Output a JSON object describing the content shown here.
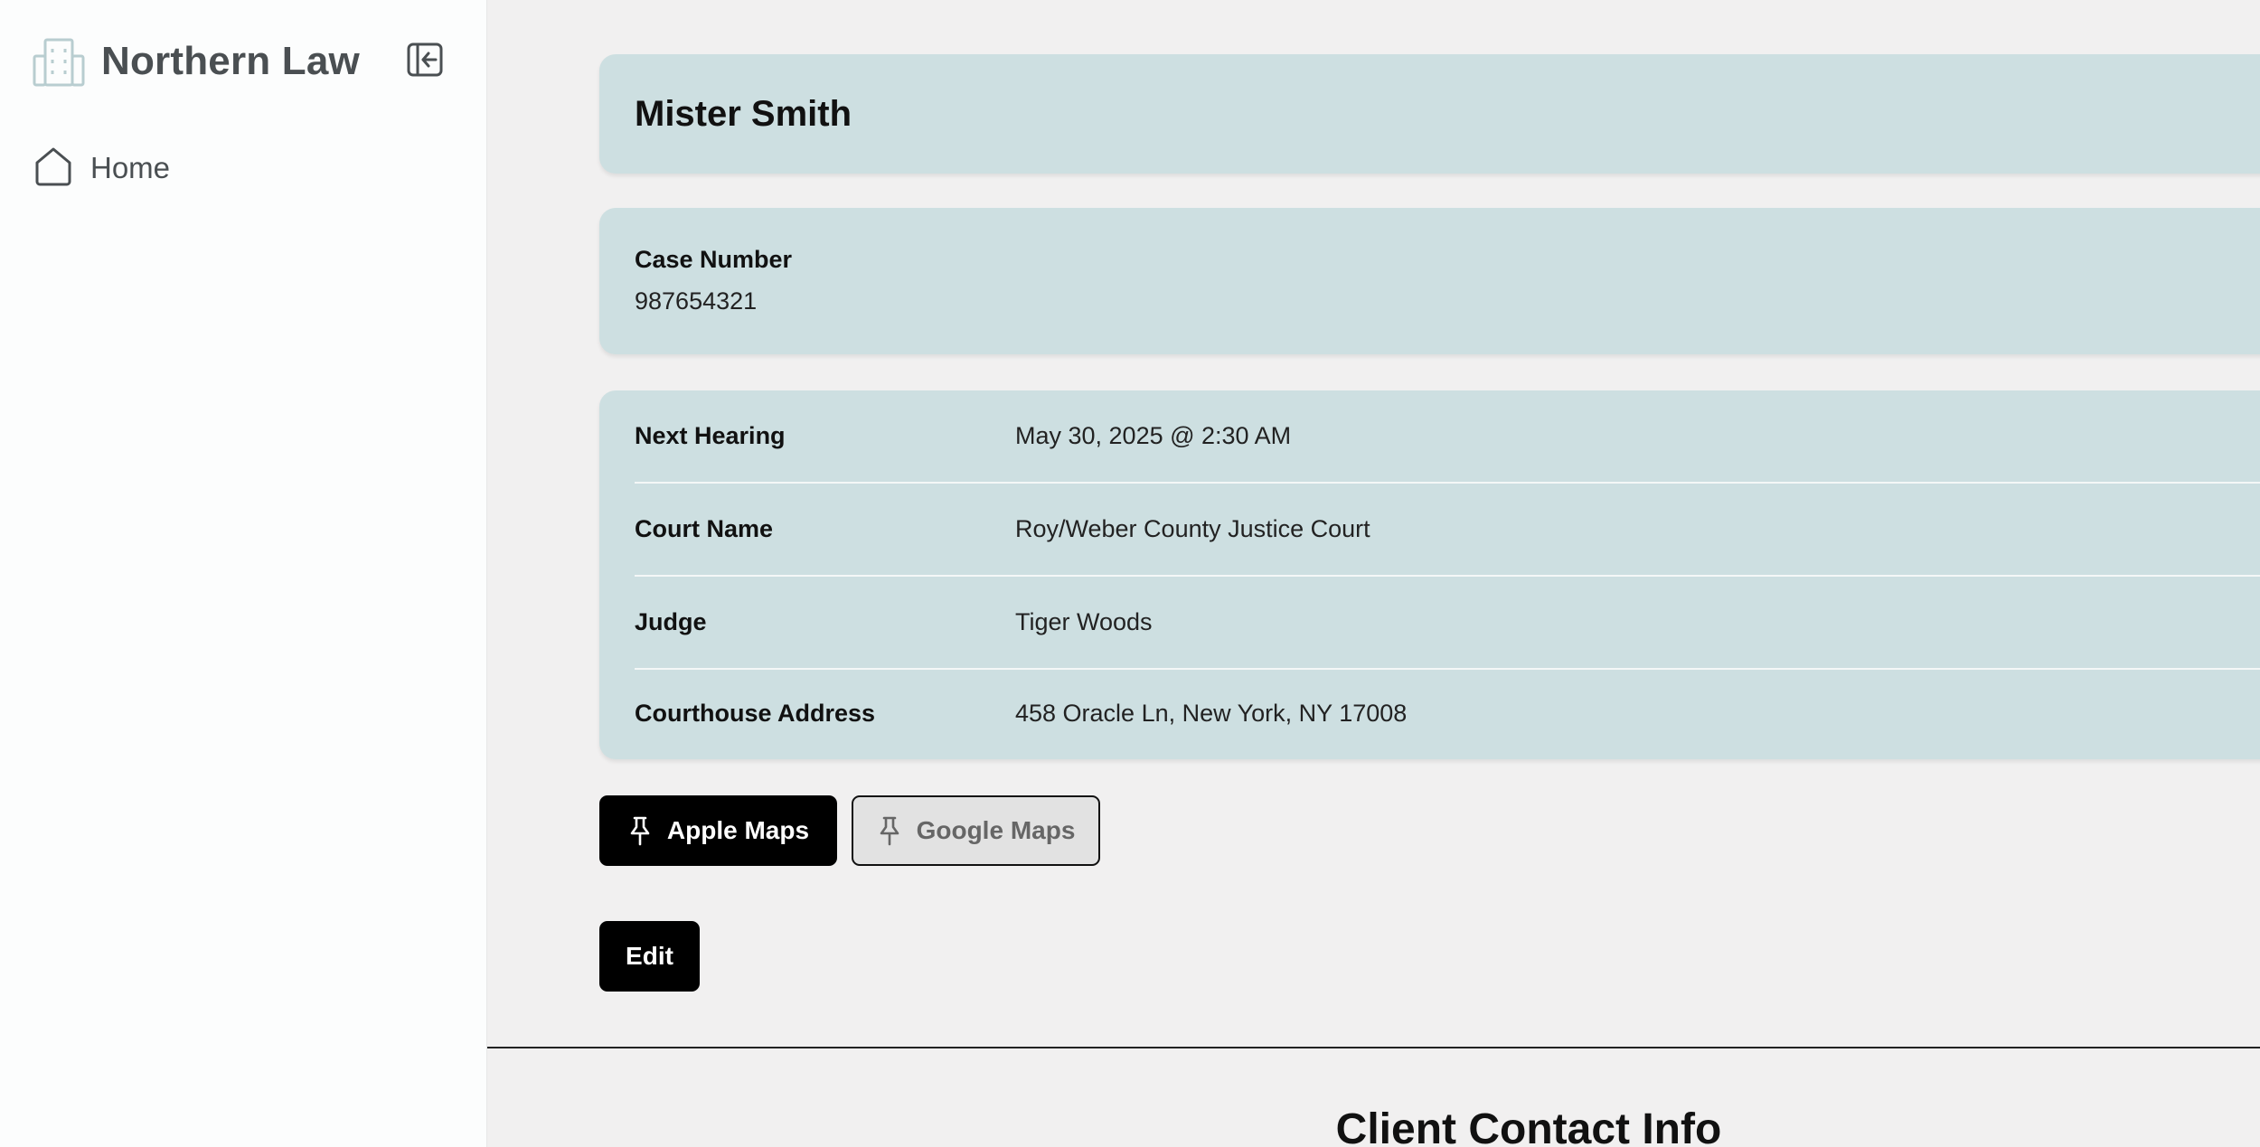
{
  "brand": {
    "name": "Northern Law",
    "icon": "building-icon"
  },
  "sidebar": {
    "collapse_icon": "collapse-sidebar-icon",
    "items": [
      {
        "label": "Home",
        "icon": "home-icon"
      }
    ]
  },
  "client": {
    "name": "Mister Smith"
  },
  "case": {
    "label": "Case Number",
    "value": "987654321"
  },
  "details": [
    {
      "label": "Next Hearing",
      "value": "May 30, 2025 @ 2:30 AM"
    },
    {
      "label": "Court Name",
      "value": "Roy/Weber County Justice Court"
    },
    {
      "label": "Judge",
      "value": "Tiger Woods"
    },
    {
      "label": "Courthouse Address",
      "value": "458 Oracle Ln, New York, NY 17008"
    }
  ],
  "buttons": {
    "apple_maps": "Apple Maps",
    "google_maps": "Google Maps",
    "edit": "Edit",
    "map_icon": "pin-icon"
  },
  "section": {
    "title": "Client Contact Info"
  },
  "colors": {
    "card_bg": "#cddfe1",
    "page_bg": "#f1f0f0",
    "primary_button": "#000000"
  }
}
